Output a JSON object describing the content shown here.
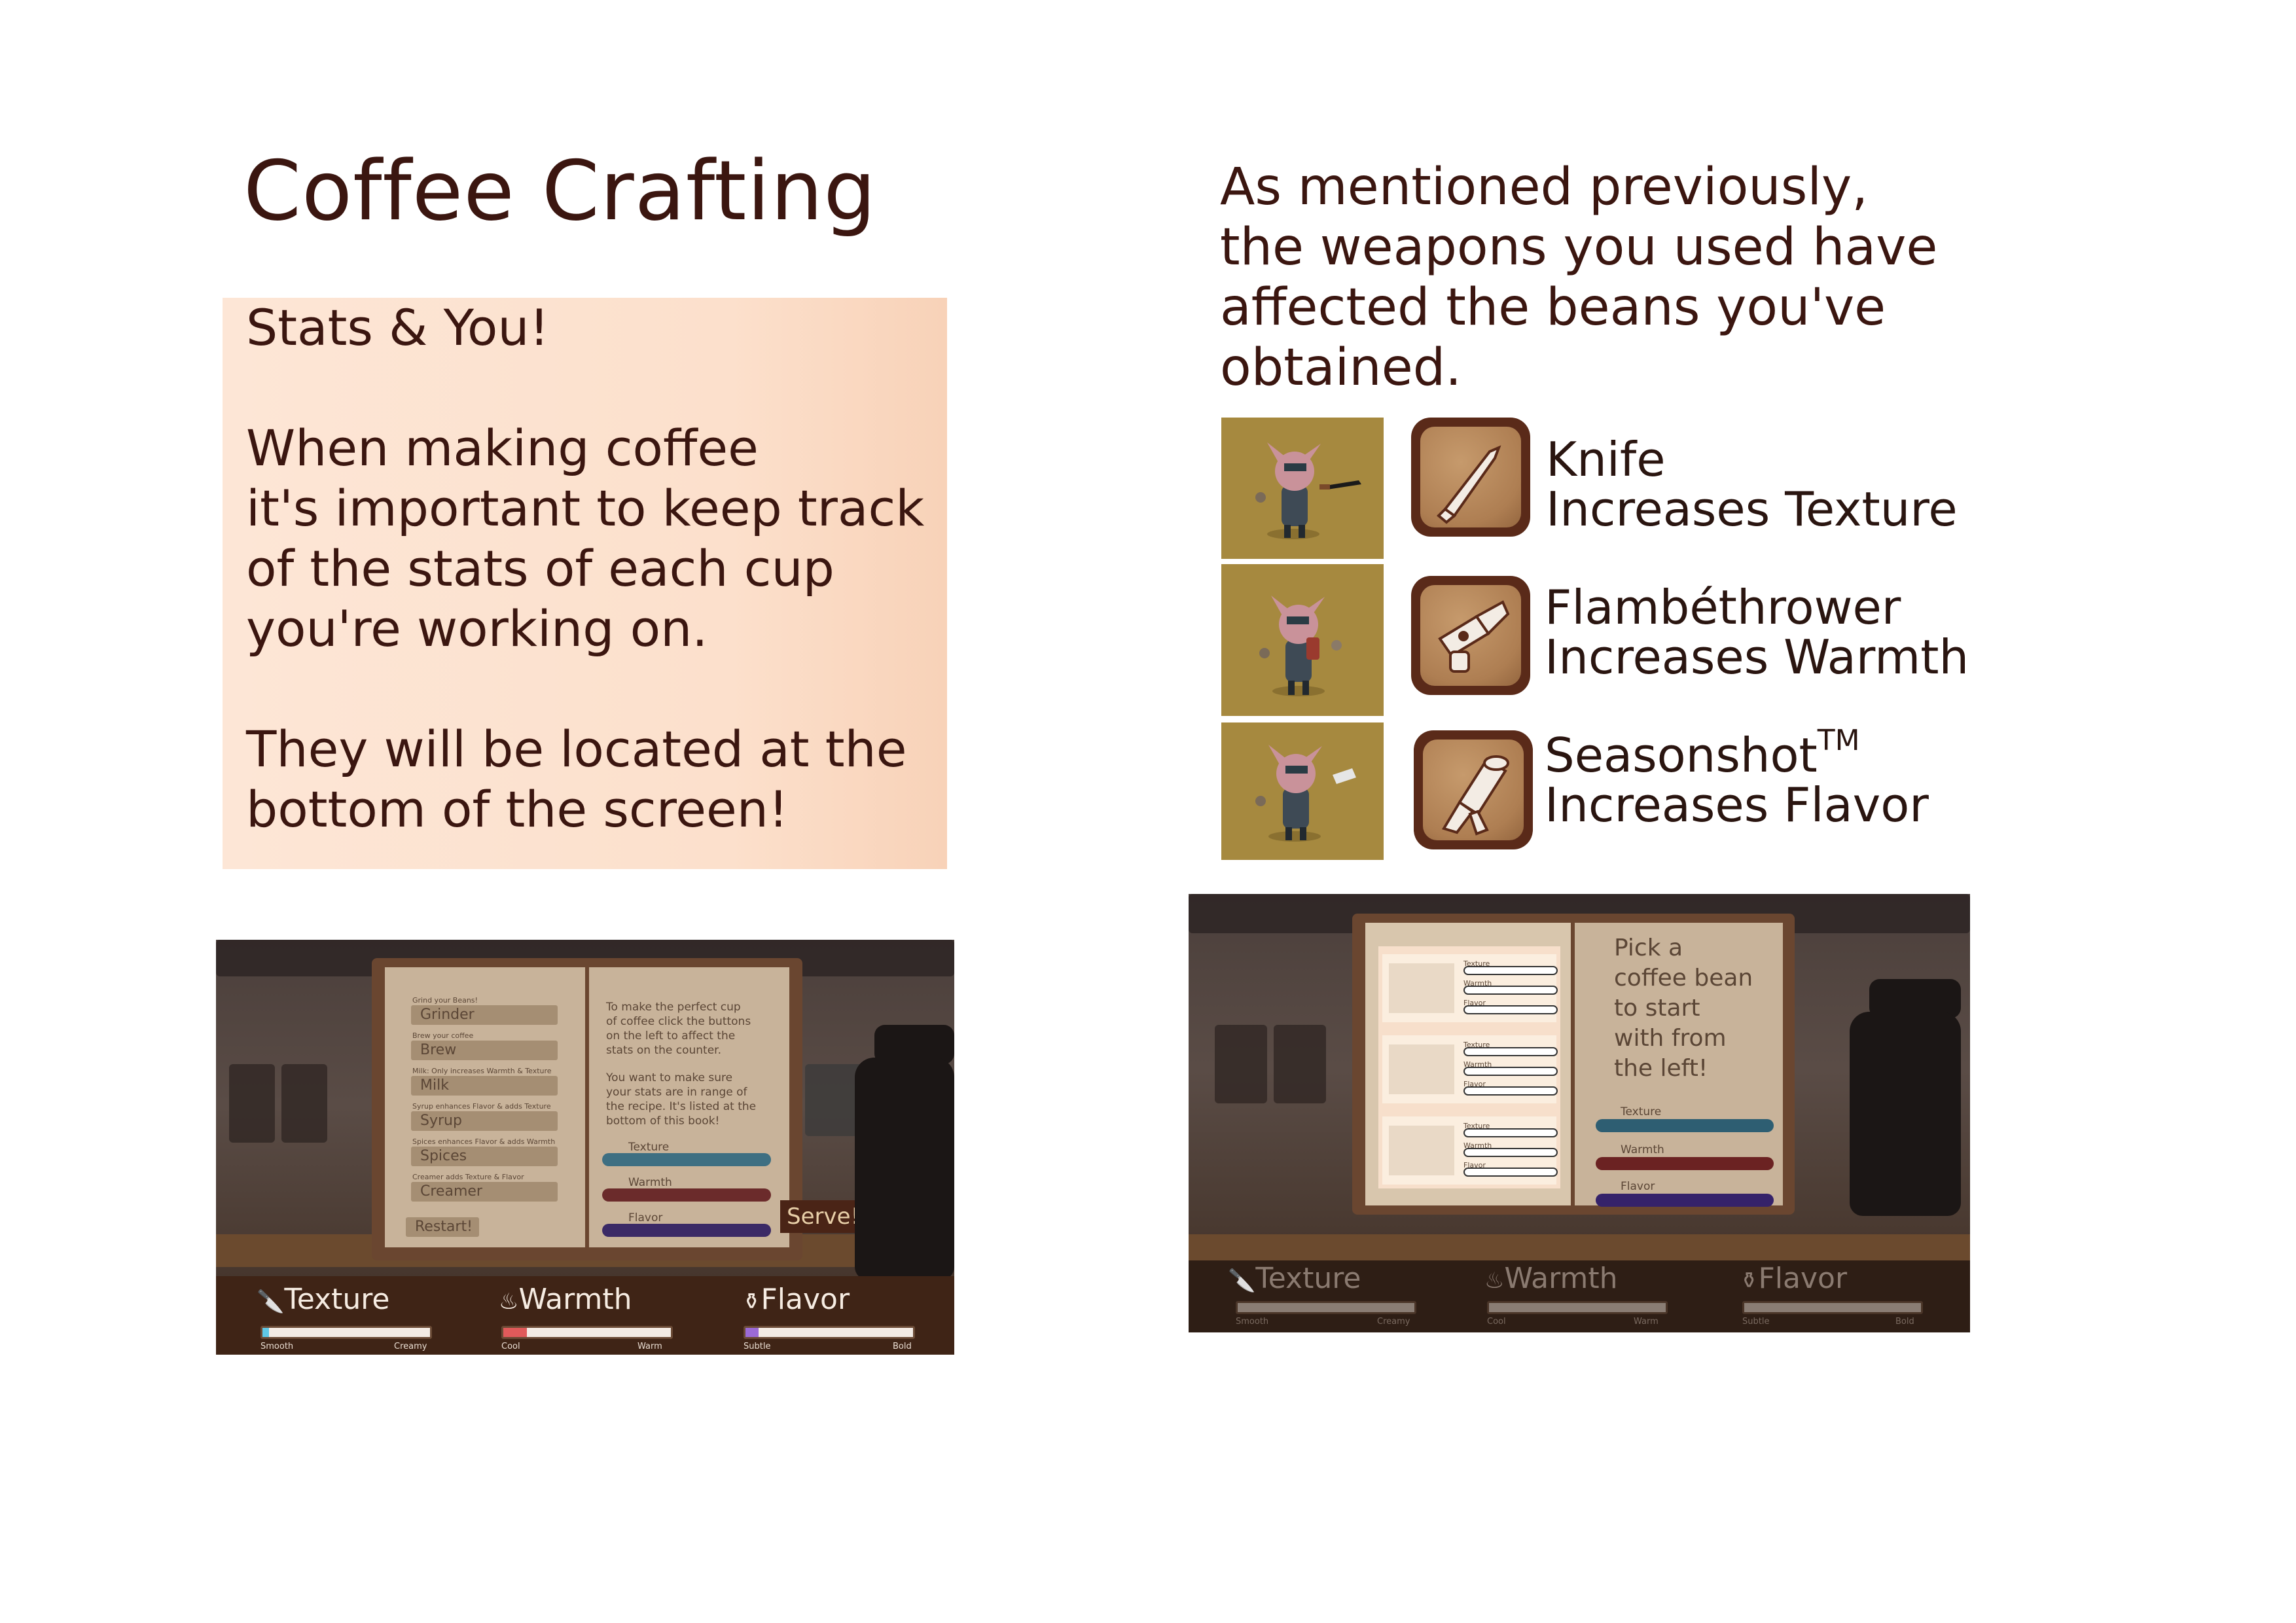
{
  "page": {
    "title": "Coffee Crafting"
  },
  "stats_box": {
    "heading": "Stats & You!",
    "para1_lines": [
      "When making coffee",
      "it's important to keep track",
      "of the stats of each cup",
      "you're working on."
    ],
    "para2_lines": [
      "They will be located at the",
      "bottom of the screen!"
    ]
  },
  "intro": {
    "lines": [
      "As mentioned previously,",
      "the weapons you used have",
      "affected the beans you've",
      "obtained."
    ]
  },
  "weapons": [
    {
      "name": "Knife",
      "effect": "Increases Texture",
      "icon": "knife-icon"
    },
    {
      "name": "Flambéthrower",
      "effect": "Increases Warmth",
      "icon": "flamethrower-icon"
    },
    {
      "name": "Seasonshot",
      "name_suffix": "TM",
      "effect": "Increases Flavor",
      "icon": "salt-shaker-gun-icon"
    }
  ],
  "game_left": {
    "book_left_rows": [
      {
        "hint": "Grind your Beans!",
        "label": "Grinder"
      },
      {
        "hint": "Brew your coffee",
        "label": "Brew"
      },
      {
        "hint": "Milk: Only increases Warmth & Texture",
        "label": "Milk"
      },
      {
        "hint": "Syrup enhances Flavor & adds Texture",
        "label": "Syrup"
      },
      {
        "hint": "Spices enhances Flavor & adds Warmth",
        "label": "Spices"
      },
      {
        "hint": "Creamer adds Texture & Flavor",
        "label": "Creamer"
      }
    ],
    "restart_label": "Restart!",
    "book_right_lines": [
      "To make the perfect cup",
      "of coffee click the buttons",
      "on the left to affect the",
      "stats on the counter.",
      "",
      "You want to make sure",
      "your stats are in range of",
      "the recipe. It's listed at the",
      "bottom of this book!"
    ],
    "book_stats": [
      "Texture",
      "Warmth",
      "Flavor"
    ],
    "serve_label": "Serve!",
    "bottom_stats": [
      {
        "label": "Texture",
        "low": "Smooth",
        "high": "Creamy",
        "color": "#5fc8e6",
        "level": 0.04
      },
      {
        "label": "Warmth",
        "low": "Cool",
        "high": "Warm",
        "color": "#e05a5a",
        "level": 0.14
      },
      {
        "label": "Flavor",
        "low": "Subtle",
        "high": "Bold",
        "color": "#9b6ad6",
        "level": 0.08
      }
    ]
  },
  "game_right": {
    "pick_lines": [
      "Pick a",
      "coffee bean",
      "to start",
      "with from",
      "the left!"
    ],
    "bean_stat_labels": [
      "Texture",
      "Warmth",
      "Flavor"
    ],
    "book_stats": [
      "Texture",
      "Warmth",
      "Flavor"
    ],
    "bottom_stats": [
      {
        "label": "Texture",
        "low": "Smooth",
        "high": "Creamy"
      },
      {
        "label": "Warmth",
        "low": "Cool",
        "high": "Warm"
      },
      {
        "label": "Flavor",
        "low": "Subtle",
        "high": "Bold"
      }
    ]
  },
  "colors": {
    "title": "#3b1610",
    "stats_box_bg": "#fde6d6",
    "weapon_tile": "#a6893f",
    "icon_border": "#5a2a19"
  }
}
